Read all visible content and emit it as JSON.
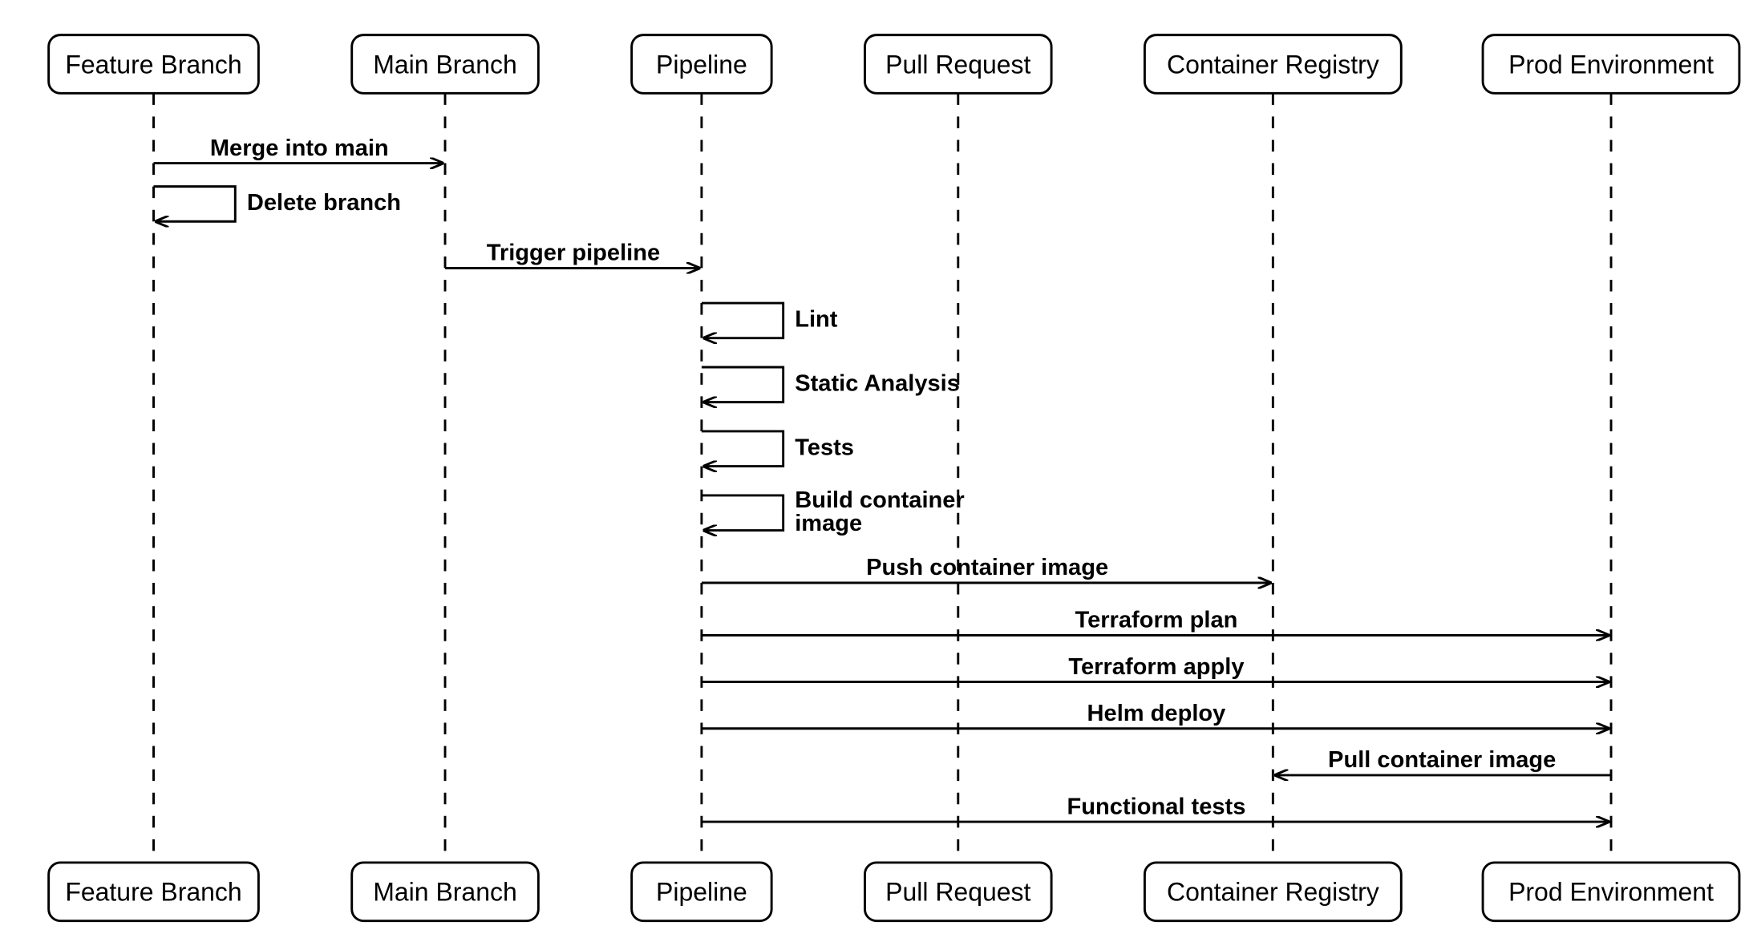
{
  "diagram": {
    "type": "sequence",
    "actors": [
      {
        "id": "feature",
        "label": "Feature Branch"
      },
      {
        "id": "main",
        "label": "Main Branch"
      },
      {
        "id": "pipeline",
        "label": "Pipeline"
      },
      {
        "id": "pr",
        "label": "Pull Request"
      },
      {
        "id": "registry",
        "label": "Container Registry"
      },
      {
        "id": "prod",
        "label": "Prod Environment"
      }
    ],
    "messages": [
      {
        "from": "feature",
        "to": "main",
        "label": "Merge into main",
        "self": false
      },
      {
        "from": "feature",
        "to": "feature",
        "label": "Delete branch",
        "self": true
      },
      {
        "from": "main",
        "to": "pipeline",
        "label": "Trigger pipeline",
        "self": false
      },
      {
        "from": "pipeline",
        "to": "pipeline",
        "label": "Lint",
        "self": true
      },
      {
        "from": "pipeline",
        "to": "pipeline",
        "label": "Static Analysis",
        "self": true
      },
      {
        "from": "pipeline",
        "to": "pipeline",
        "label": "Tests",
        "self": true
      },
      {
        "from": "pipeline",
        "to": "pipeline",
        "label": "Build container image",
        "self": true,
        "wrap": true
      },
      {
        "from": "pipeline",
        "to": "registry",
        "label": "Push container image",
        "self": false
      },
      {
        "from": "pipeline",
        "to": "prod",
        "label": "Terraform plan",
        "self": false
      },
      {
        "from": "pipeline",
        "to": "prod",
        "label": "Terraform apply",
        "self": false
      },
      {
        "from": "pipeline",
        "to": "prod",
        "label": "Helm deploy",
        "self": false
      },
      {
        "from": "prod",
        "to": "registry",
        "label": "Pull container image",
        "self": false
      },
      {
        "from": "pipeline",
        "to": "prod",
        "label": "Functional tests",
        "self": false
      }
    ]
  }
}
